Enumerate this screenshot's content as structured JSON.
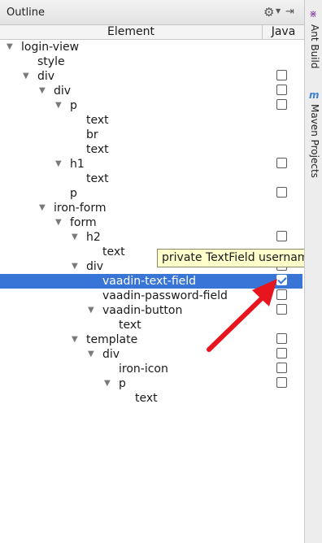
{
  "panel": {
    "title": "Outline",
    "gear_icon": "gear-icon",
    "pin_icon": "hide-panel-icon"
  },
  "header": {
    "element": "Element",
    "java": "Java"
  },
  "tree": [
    {
      "label": "login-view",
      "depth": 0,
      "expanded": true,
      "checkbox": false
    },
    {
      "label": "style",
      "depth": 1,
      "expanded": null,
      "checkbox": false
    },
    {
      "label": "div",
      "depth": 1,
      "expanded": true,
      "checkbox": true,
      "checked": false
    },
    {
      "label": "div",
      "depth": 2,
      "expanded": true,
      "checkbox": true,
      "checked": false
    },
    {
      "label": "p",
      "depth": 3,
      "expanded": true,
      "checkbox": true,
      "checked": false
    },
    {
      "label": "text",
      "depth": 4,
      "expanded": null,
      "checkbox": false
    },
    {
      "label": "br",
      "depth": 4,
      "expanded": null,
      "checkbox": false
    },
    {
      "label": "text",
      "depth": 4,
      "expanded": null,
      "checkbox": false
    },
    {
      "label": "h1",
      "depth": 3,
      "expanded": true,
      "checkbox": true,
      "checked": false
    },
    {
      "label": "text",
      "depth": 4,
      "expanded": null,
      "checkbox": false
    },
    {
      "label": "p",
      "depth": 3,
      "expanded": null,
      "checkbox": true,
      "checked": false
    },
    {
      "label": "iron-form",
      "depth": 2,
      "expanded": true,
      "checkbox": false
    },
    {
      "label": "form",
      "depth": 3,
      "expanded": true,
      "checkbox": false
    },
    {
      "label": "h2",
      "depth": 4,
      "expanded": true,
      "checkbox": true,
      "checked": false
    },
    {
      "label": "text",
      "depth": 5,
      "expanded": null,
      "checkbox": false
    },
    {
      "label": "div",
      "depth": 4,
      "expanded": true,
      "checkbox": true,
      "checked": false
    },
    {
      "label": "vaadin-text-field",
      "depth": 5,
      "expanded": null,
      "checkbox": true,
      "checked": true,
      "selected": true
    },
    {
      "label": "vaadin-password-field",
      "depth": 5,
      "expanded": null,
      "checkbox": true,
      "checked": false
    },
    {
      "label": "vaadin-button",
      "depth": 5,
      "expanded": true,
      "checkbox": true,
      "checked": false
    },
    {
      "label": "text",
      "depth": 6,
      "expanded": null,
      "checkbox": false
    },
    {
      "label": "template",
      "depth": 4,
      "expanded": true,
      "checkbox": true,
      "checked": false
    },
    {
      "label": "div",
      "depth": 5,
      "expanded": true,
      "checkbox": true,
      "checked": false
    },
    {
      "label": "iron-icon",
      "depth": 6,
      "expanded": null,
      "checkbox": true,
      "checked": false
    },
    {
      "label": "p",
      "depth": 6,
      "expanded": true,
      "checkbox": true,
      "checked": false
    },
    {
      "label": "text",
      "depth": 7,
      "expanded": null,
      "checkbox": false
    }
  ],
  "tooltip": "private TextField username",
  "side_tabs": [
    {
      "icon": "ant-icon",
      "label": "Ant Build"
    },
    {
      "icon": "maven-icon",
      "label": "Maven Projects"
    }
  ],
  "annotation": {
    "type": "red-arrow",
    "color": "#e8141e"
  },
  "colors": {
    "selection": "#3875d7",
    "tooltip_bg": "#ffffcc"
  }
}
